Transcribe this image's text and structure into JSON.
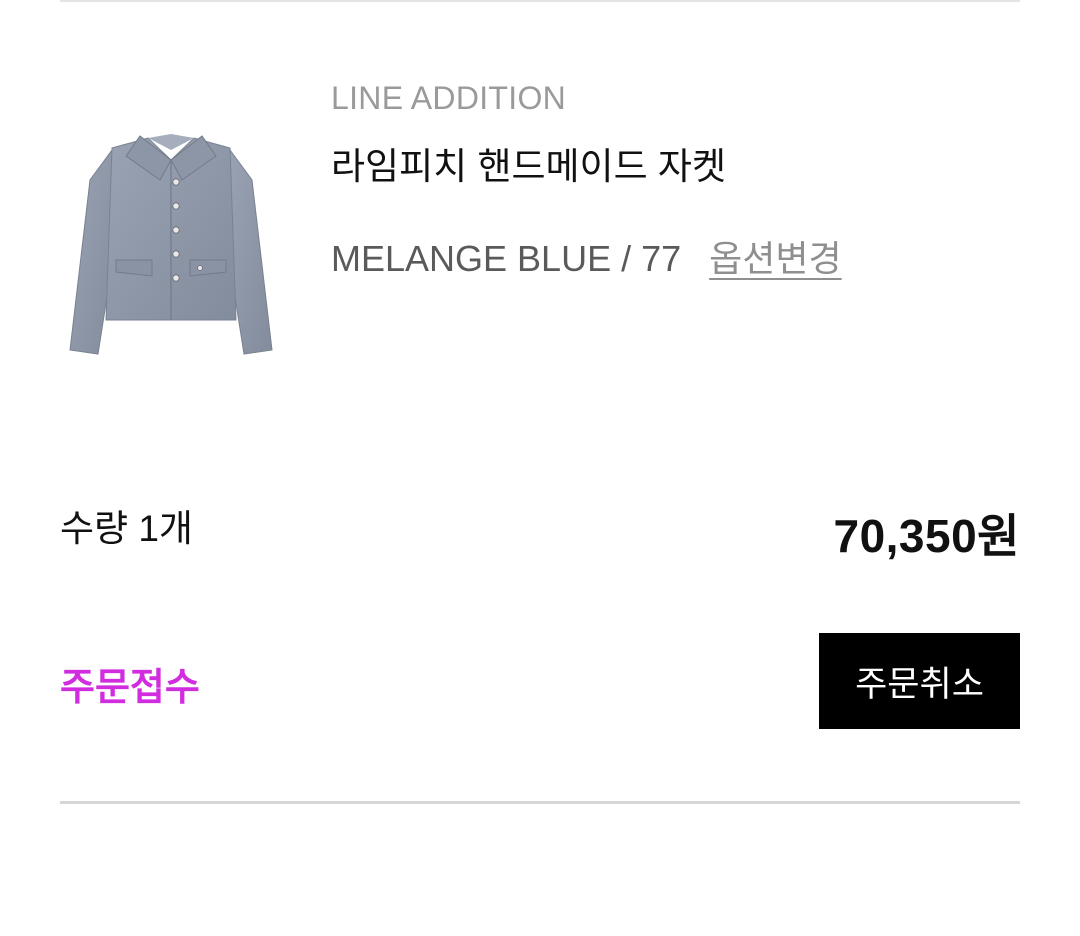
{
  "product": {
    "brand": "LINE ADDITION",
    "name": "라임피치 핸드메이드 자켓",
    "option": "MELANGE BLUE / 77",
    "option_change_label": "옵션변경",
    "image_icon": "jacket-product-image"
  },
  "order": {
    "quantity_label": "수량 1개",
    "price": "70,350원",
    "status": "주문접수",
    "cancel_label": "주문취소"
  },
  "colors": {
    "status": "#d12ce0",
    "button_bg": "#000000",
    "button_text": "#ffffff",
    "jacket": "#8f98a8"
  }
}
